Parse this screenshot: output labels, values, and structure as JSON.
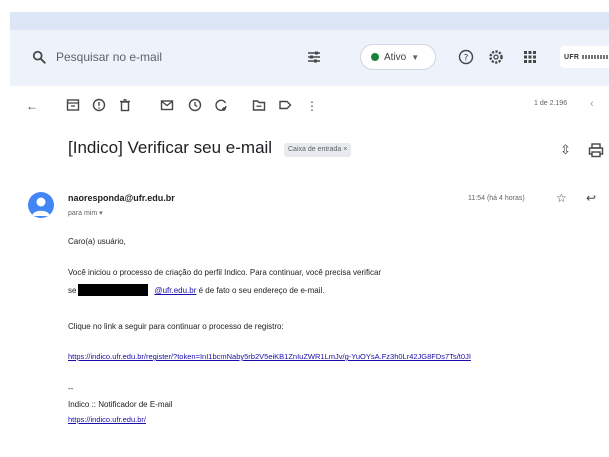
{
  "search": {
    "placeholder": "Pesquisar no e-mail"
  },
  "status": {
    "label": "Ativo",
    "color": "#188038"
  },
  "header_icons": [
    "help-icon",
    "settings-icon",
    "apps-grid-icon"
  ],
  "account": {
    "label": "UFR"
  },
  "toolbar": {
    "icons": [
      "back-arrow-icon",
      "archive-icon",
      "report-spam-icon",
      "delete-icon",
      "mark-unread-icon",
      "snooze-icon",
      "add-task-icon",
      "move-to-icon",
      "label-icon",
      "more-vert-icon"
    ],
    "pager": "1 de 2.196"
  },
  "message": {
    "subject": "[Indico] Verificar seu e-mail",
    "label_chip": "Caixa de entrada ×",
    "sender": "naoresponda@ufr.edu.br",
    "to": "para mim ▾",
    "time": "11:54 (há 4 horas)",
    "greeting": "Caro(a) usuário,",
    "para1_line1": "Você iniciou o processo de criação do perfil Indico. Para continuar, você precisa verificar",
    "para1_prefix": "se",
    "para1_email_link": "@ufr.edu.br",
    "para1_suffix": " é de fato o seu endereço de e-mail.",
    "para2": "Clique no link a seguir para continuar o processo de registro:",
    "register_link": "https://indico.ufr.edu.br/register/?token=InI1bcmNaby5rb2V5eiKB1ZnIuZWR1LmJv/g-YuOYsA.Fz3h0Lr42JG8FDs7Ts/t0JI",
    "sig_dash": "--",
    "sig_name": "Indico :: Notificador de E-mail",
    "sig_link": "https://indico.ufr.edu.br/"
  }
}
